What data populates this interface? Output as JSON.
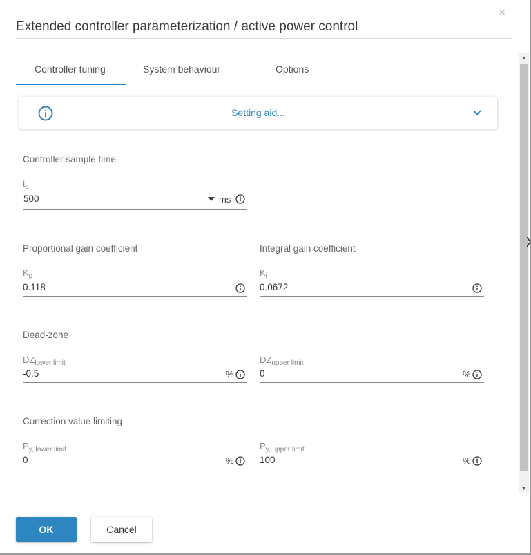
{
  "dialog": {
    "title": "Extended controller parameterization / active power control",
    "close_symbol": "×"
  },
  "tabs": [
    {
      "label": "Controller tuning",
      "active": true
    },
    {
      "label": "System behaviour",
      "active": false
    },
    {
      "label": "Options",
      "active": false
    }
  ],
  "setting_aid": {
    "label": "Setting aid...",
    "icon": "info-circle-icon",
    "expand_icon": "chevron-down-icon"
  },
  "sample_time": {
    "section": "Controller sample time",
    "symbol": "t",
    "sub": "s",
    "value": "500",
    "unit": "ms"
  },
  "proportional": {
    "section": "Proportional gain coefficient",
    "symbol": "K",
    "sub": "p",
    "value": "0.118"
  },
  "integral": {
    "section": "Integral gain coefficient",
    "symbol": "K",
    "sub": "i",
    "value": "0.0672"
  },
  "dead_zone": {
    "section": "Dead-zone",
    "lower": {
      "symbol": "DZ",
      "sub": "lower limit",
      "value": "-0.5",
      "unit": "%"
    },
    "upper": {
      "symbol": "DZ",
      "sub": "upper limit",
      "value": "0",
      "unit": "%"
    }
  },
  "correction": {
    "section": "Correction value limiting",
    "lower": {
      "symbol": "P",
      "sub": "y, lower limit",
      "value": "0",
      "unit": "%"
    },
    "upper": {
      "symbol": "P",
      "sub": "y, upper limit",
      "value": "100",
      "unit": "%"
    }
  },
  "buttons": {
    "ok": "OK",
    "cancel": "Cancel"
  },
  "colors": {
    "accent": "#2e86c1",
    "tab_underline": "#2a7fc1"
  }
}
